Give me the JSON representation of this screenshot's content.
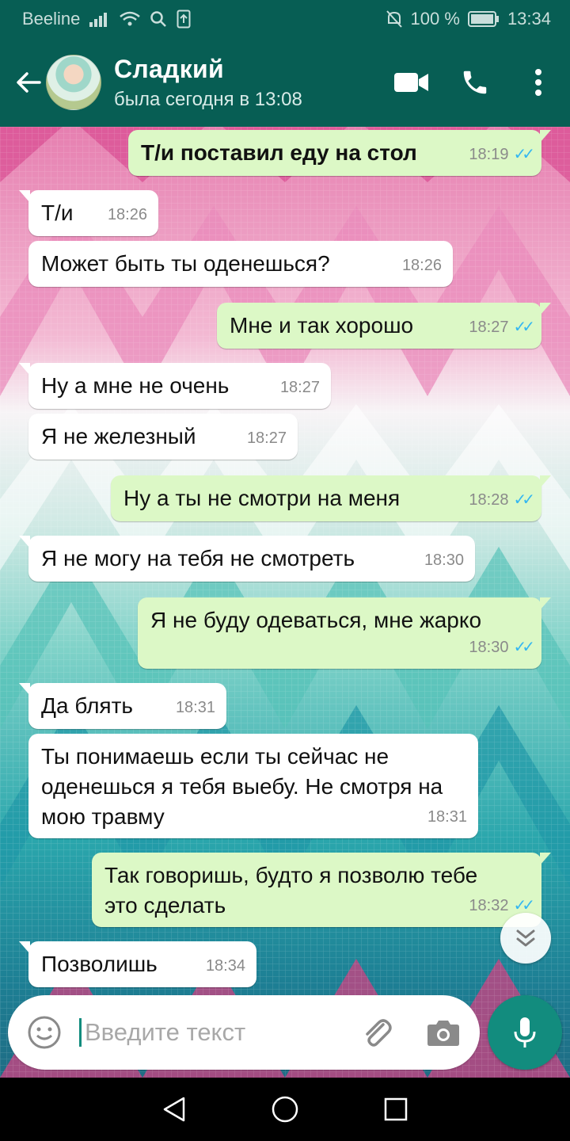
{
  "status_bar": {
    "carrier": "Beeline",
    "battery_percent": "100 %",
    "time": "13:34"
  },
  "header": {
    "contact_name": "Сладкий",
    "last_seen": "была сегодня в 13:08"
  },
  "messages": [
    {
      "dir": "out",
      "text": "Т/и поставил еду на стол",
      "time": "18:19",
      "read": true,
      "bold": true
    },
    {
      "dir": "in",
      "text": "Т/и",
      "time": "18:26"
    },
    {
      "dir": "in",
      "text": "Может быть ты оденешься?",
      "time": "18:26"
    },
    {
      "dir": "out",
      "text": "Мне и так хорошо",
      "time": "18:27",
      "read": true
    },
    {
      "dir": "in",
      "text": "Ну а мне не очень",
      "time": "18:27"
    },
    {
      "dir": "in",
      "text": "Я не железный",
      "time": "18:27"
    },
    {
      "dir": "out",
      "text": "Ну а ты не смотри на меня",
      "time": "18:28",
      "read": true
    },
    {
      "dir": "in",
      "text": "Я не могу на тебя не смотреть",
      "time": "18:30"
    },
    {
      "dir": "out",
      "text": "Я не буду одеваться, мне жарко",
      "time": "18:30",
      "read": true
    },
    {
      "dir": "in",
      "text": "Да блять",
      "time": "18:31"
    },
    {
      "dir": "in",
      "text": "Ты понимаешь если ты сейчас не оденешься я тебя выебу. Не смотря на мою травму",
      "time": "18:31"
    },
    {
      "dir": "out",
      "text": "Так говоришь, будто я позволю тебе это сделать",
      "time": "18:32",
      "read": true
    },
    {
      "dir": "in",
      "text": "Позволишь",
      "time": "18:34"
    }
  ],
  "input": {
    "placeholder": "Введите текст",
    "value": ""
  },
  "colors": {
    "header": "#075e54",
    "outgoing_bubble": "#dcf8c6",
    "incoming_bubble": "#ffffff",
    "accent": "#128c7e",
    "read_ticks": "#34b7f1"
  }
}
